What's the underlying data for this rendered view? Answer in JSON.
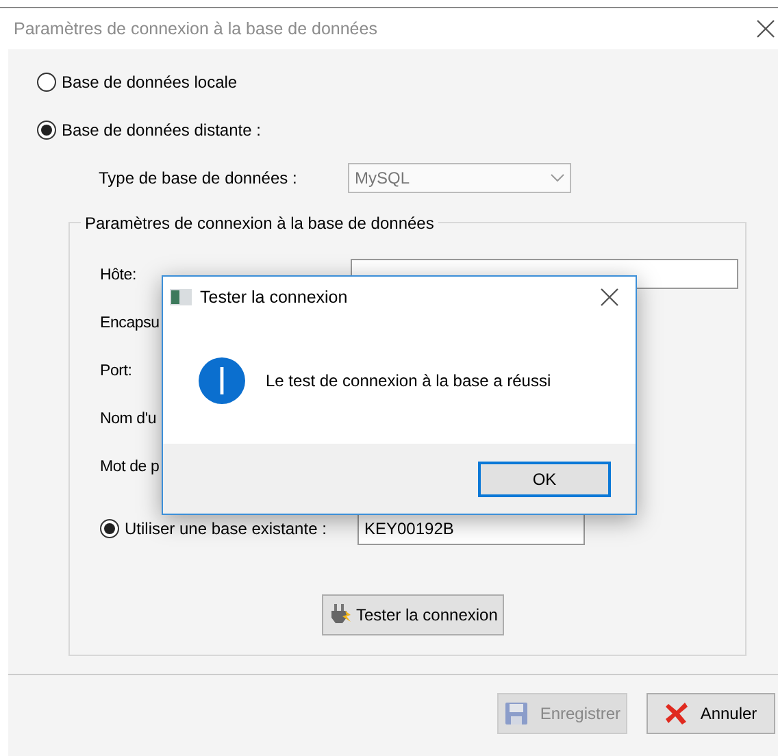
{
  "window": {
    "title": "Paramètres de connexion à la base de données"
  },
  "radios": [
    {
      "label": "Base de données locale",
      "selected": false
    },
    {
      "label": "Base de données distante :",
      "selected": true
    }
  ],
  "db_type": {
    "label": "Type de base de données :",
    "value": "MySQL",
    "disabled": true
  },
  "group": {
    "title": "Paramètres de connexion à la base de données",
    "rows": [
      {
        "label": "Hôte:",
        "kind": "field"
      },
      {
        "label": "Encapsu",
        "kind": "label"
      },
      {
        "label": "Port:",
        "kind": "label"
      },
      {
        "label": "Nom d'u",
        "kind": "label"
      },
      {
        "label": "Mot de p",
        "kind": "label"
      }
    ],
    "existing": {
      "label": "Utiliser une base existante :",
      "selected": true,
      "value": "KEY00192B"
    },
    "test_button": {
      "label": "Tester la connexion"
    }
  },
  "buttons": [
    {
      "label": "Enregistrer",
      "kind": "save",
      "disabled": true
    },
    {
      "label": "Annuler",
      "kind": "cancel",
      "disabled": false
    }
  ],
  "dialog": {
    "title": "Tester la connexion",
    "message": "Le test de connexion à la base a réussi",
    "button": "OK"
  }
}
